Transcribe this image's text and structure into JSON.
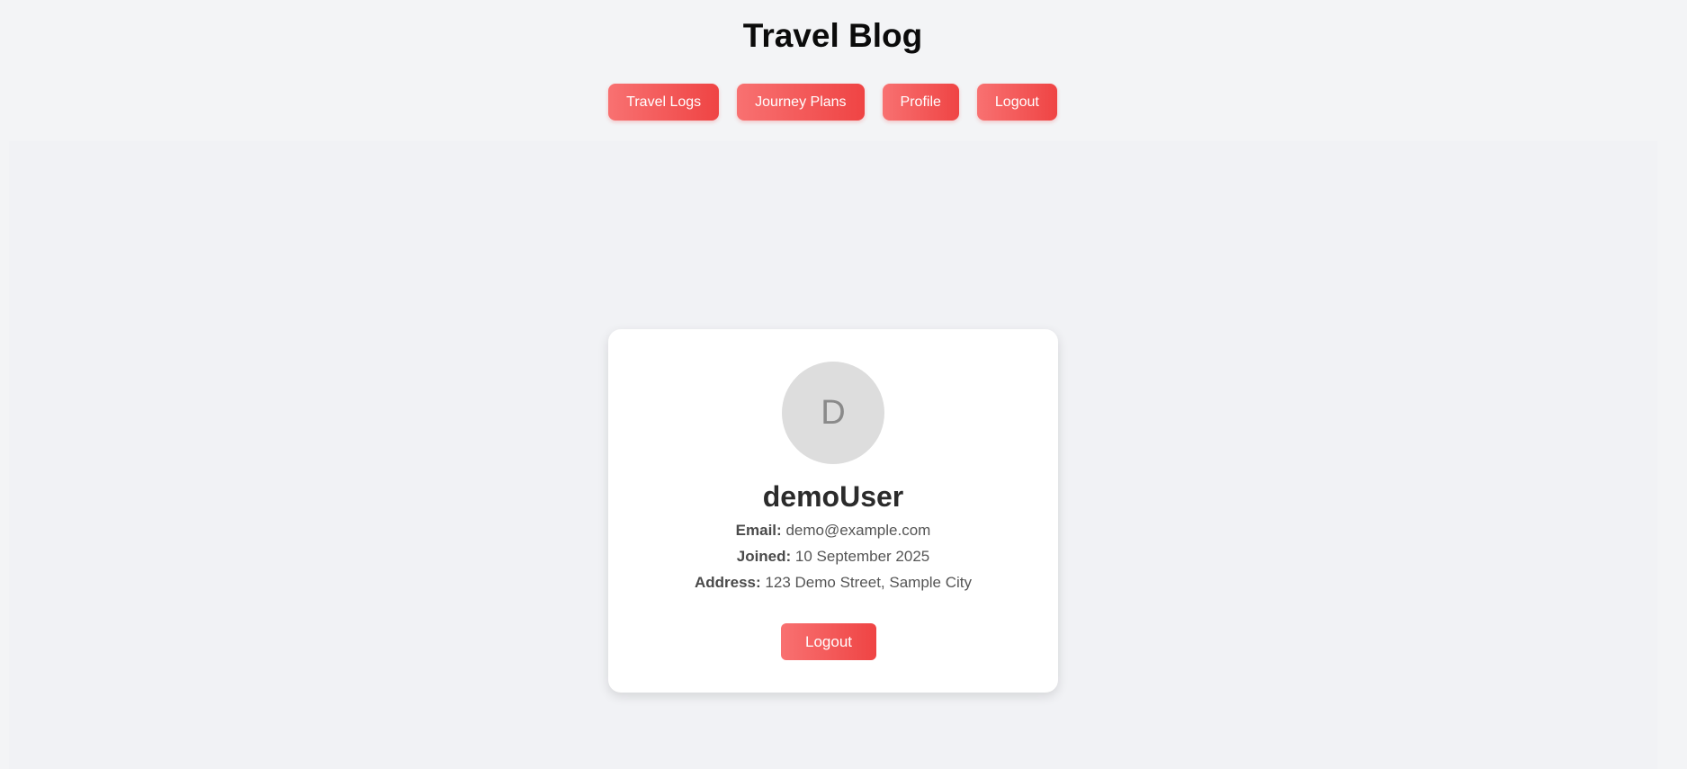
{
  "header": {
    "title": "Travel Blog",
    "nav": [
      {
        "label": "Travel Logs"
      },
      {
        "label": "Journey Plans"
      },
      {
        "label": "Profile"
      },
      {
        "label": "Logout"
      }
    ]
  },
  "profile": {
    "avatar_initial": "D",
    "username": "demoUser",
    "email_label": "Email:",
    "email": "demo@example.com",
    "joined_label": "Joined:",
    "joined": "10 September 2025",
    "address_label": "Address:",
    "address": "123 Demo Street, Sample City",
    "logout_label": "Logout"
  },
  "colors": {
    "accent_start": "#f87171",
    "accent_end": "#ef4444",
    "background": "#f3f4f6",
    "card": "#ffffff"
  }
}
